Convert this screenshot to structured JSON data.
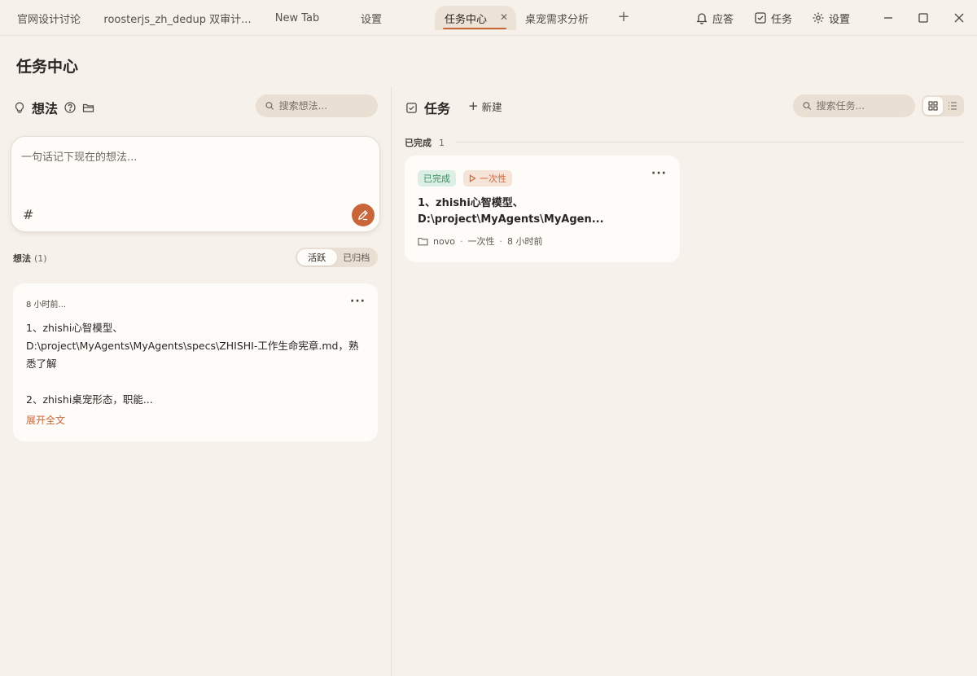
{
  "titlebar": {
    "tabs": [
      {
        "label": "官网设计讨论"
      },
      {
        "label": "roosterjs_zh_dedup 双审计..."
      },
      {
        "label": "New Tab"
      },
      {
        "label": "设置"
      },
      {
        "label": "任务中心",
        "active": true
      },
      {
        "label": "桌宠需求分析"
      }
    ],
    "actions": {
      "answer": "应答",
      "tasks": "任务",
      "settings": "设置"
    }
  },
  "page": {
    "title": "任务中心"
  },
  "ideas": {
    "heading": "想法",
    "search_placeholder": "搜索想法...",
    "composer_placeholder": "一句话记下现在的想法...",
    "hash_symbol": "#",
    "list_label": "想法",
    "list_count": "(1)",
    "filters": {
      "active": "活跃",
      "archived": "已归档"
    },
    "items": [
      {
        "time": "8 小时前...",
        "body": "1、zhishi心智模型、\nD:\\project\\MyAgents\\MyAgents\\specs\\ZHISHI-工作生命宪章.md，熟悉了解\n\n2、zhishi桌宠形态，职能...",
        "expand": "展开全文"
      }
    ]
  },
  "tasks": {
    "heading": "任务",
    "new_label": "新建",
    "search_placeholder": "搜索任务...",
    "group": {
      "label": "已完成",
      "count": "1"
    },
    "items": [
      {
        "status": "已完成",
        "type": "一次性",
        "title": "1、zhishi心智模型、D:\\project\\MyAgents\\MyAgen...",
        "project": "novo",
        "meta_type": "一次性",
        "time": "8 小时前"
      }
    ]
  },
  "colors": {
    "accent": "#c8663a",
    "background": "#f6f1ea",
    "card": "#fefcf8",
    "done_badge": "#dcefe4"
  }
}
